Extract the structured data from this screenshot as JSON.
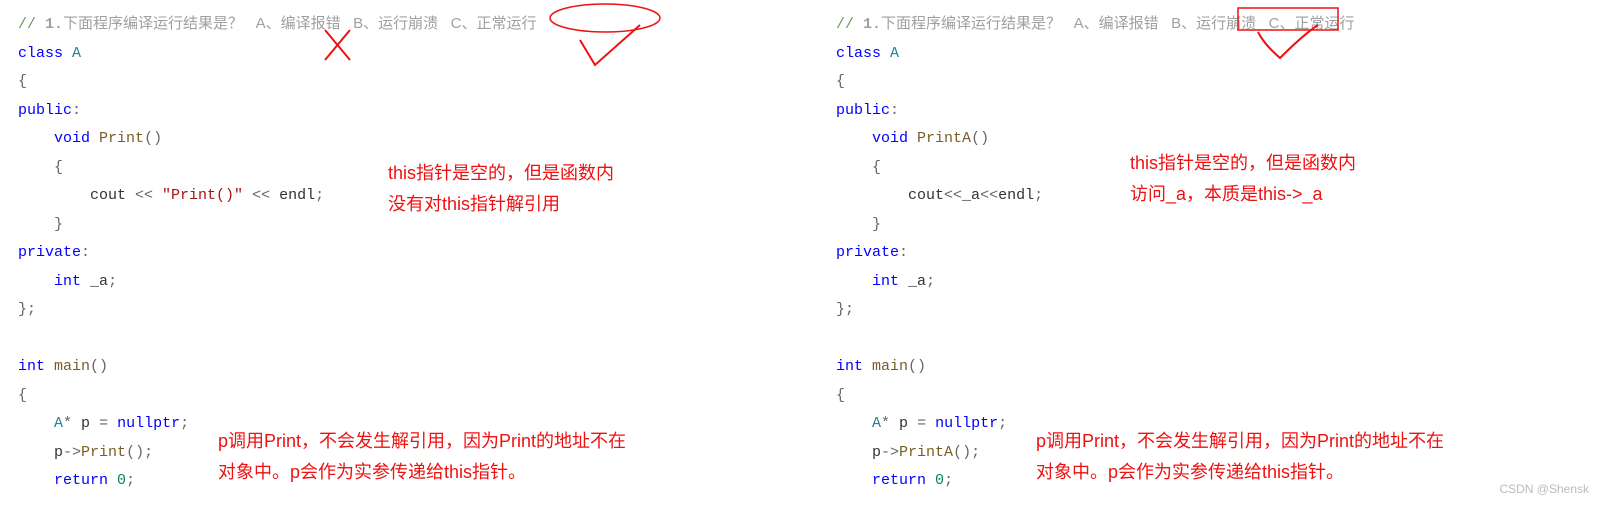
{
  "left": {
    "question": {
      "prefix": "// ",
      "num": "1.",
      "text": "下面程序编译运行结果是？",
      "gap1": "   ",
      "optA": "A、编译报错",
      "gap2": "   ",
      "optB": "B、运行崩溃",
      "gap3": "   ",
      "optC": "C、正常运行"
    },
    "code": {
      "l1_kw": "class",
      "l1_sp": " ",
      "l1_name": "A",
      "l2": "{",
      "l3_kw": "public",
      "l3_colon": ":",
      "l4_pad": "    ",
      "l4_kw": "void",
      "l4_sp": " ",
      "l4_fn": "Print",
      "l4_par": "()",
      "l5": "    {",
      "l6_pad": "        ",
      "l6_cout": "cout",
      "l6_op1": " << ",
      "l6_str": "\"Print()\"",
      "l6_op2": " << ",
      "l6_endl": "endl",
      "l6_semi": ";",
      "l7": "    }",
      "l8_kw": "private",
      "l8_colon": ":",
      "l9_pad": "    ",
      "l9_kw": "int",
      "l9_sp": " ",
      "l9_var": "_a",
      "l9_semi": ";",
      "l10": "};",
      "l11": "",
      "l12_kw": "int",
      "l12_sp": " ",
      "l12_fn": "main",
      "l12_par": "()",
      "l13": "{",
      "l14_pad": "    ",
      "l14_type": "A",
      "l14_sp1": "* ",
      "l14_var": "p",
      "l14_eq": " = ",
      "l14_null": "nullptr",
      "l14_semi": ";",
      "l15_pad": "    ",
      "l15_var": "p",
      "l15_arrow": "->",
      "l15_fn": "Print",
      "l15_call": "();",
      "l16_pad": "    ",
      "l16_kw": "return",
      "l16_sp": " ",
      "l16_num": "0",
      "l16_semi": ";"
    },
    "annot_top": "this指针是空的，但是函数内\n没有对this指针解引用",
    "annot_bottom": "p调用Print，不会发生解引用，因为Print的地址不在\n对象中。p会作为实参传递给this指针。"
  },
  "right": {
    "question": {
      "prefix": "// ",
      "num": "1.",
      "text": "下面程序编译运行结果是？",
      "gap1": "   ",
      "optA": "A、编译报错",
      "gap2": "   ",
      "optB": "B、运行崩溃",
      "gap3": "   ",
      "optC": "C、正常运行"
    },
    "code": {
      "l1_kw": "class",
      "l1_sp": " ",
      "l1_name": "A",
      "l2": "{",
      "l3_kw": "public",
      "l3_colon": ":",
      "l4_pad": "    ",
      "l4_kw": "void",
      "l4_sp": " ",
      "l4_fn": "PrintA",
      "l4_par": "()",
      "l5": "    {",
      "l6_pad": "        ",
      "l6_cout": "cout",
      "l6_op1": "<<",
      "l6_var": "_a",
      "l6_op2": "<<",
      "l6_endl": "endl",
      "l6_semi": ";",
      "l7": "    }",
      "l8_kw": "private",
      "l8_colon": ":",
      "l9_pad": "    ",
      "l9_kw": "int",
      "l9_sp": " ",
      "l9_var": "_a",
      "l9_semi": ";",
      "l10": "};",
      "l11": "",
      "l12_kw": "int",
      "l12_sp": " ",
      "l12_fn": "main",
      "l12_par": "()",
      "l13": "{",
      "l14_pad": "    ",
      "l14_type": "A",
      "l14_sp1": "* ",
      "l14_var": "p",
      "l14_eq": " = ",
      "l14_null": "nullptr",
      "l14_semi": ";",
      "l15_pad": "    ",
      "l15_var": "p",
      "l15_arrow": "->",
      "l15_fn": "PrintA",
      "l15_call": "();",
      "l16_pad": "    ",
      "l16_kw": "return",
      "l16_sp": " ",
      "l16_num": "0",
      "l16_semi": ";"
    },
    "annot_top": "this指针是空的，但是函数内\n访问_a，本质是this->_a",
    "annot_bottom": "p调用Print，不会发生解引用，因为Print的地址不在\n对象中。p会作为实参传递给this指针。"
  },
  "watermark": "CSDN @Shensk"
}
